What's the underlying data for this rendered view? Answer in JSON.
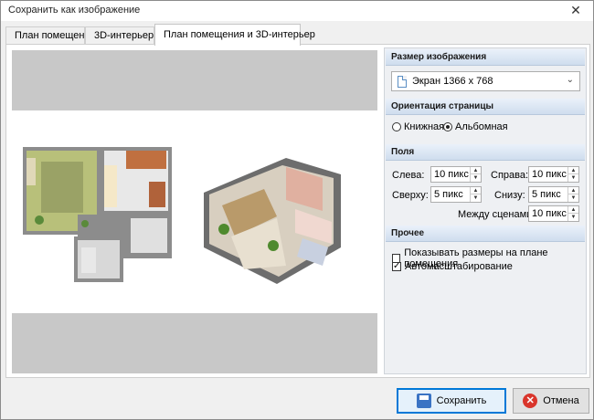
{
  "window": {
    "title": "Сохранить как изображение",
    "close_icon": "✕"
  },
  "tabs": [
    {
      "label": "План помещения"
    },
    {
      "label": "3D-интерьер"
    },
    {
      "label": "План помещения и 3D-интерьер",
      "active": true
    }
  ],
  "image_size": {
    "header": "Размер изображения",
    "selected": "Экран 1366 x 768"
  },
  "orientation": {
    "header": "Ориентация страницы",
    "options": [
      {
        "label": "Книжная",
        "selected": false
      },
      {
        "label": "Альбомная",
        "selected": true
      }
    ]
  },
  "margins": {
    "header": "Поля",
    "left_label": "Слева:",
    "left_value": "10 пикс",
    "right_label": "Справа:",
    "right_value": "10 пикс",
    "top_label": "Сверху:",
    "top_value": "5 пикс",
    "bottom_label": "Снизу:",
    "bottom_value": "5 пикс",
    "between_label": "Между сценами:",
    "between_value": "10 пикс"
  },
  "other": {
    "header": "Прочее",
    "show_sizes_label": "Показывать размеры на плане помещения",
    "show_sizes_checked": false,
    "autoscale_label": "Автомасштабирование",
    "autoscale_checked": true
  },
  "buttons": {
    "save": "Сохранить",
    "cancel": "Отмена"
  },
  "colors": {
    "accent": "#0078d7",
    "section_header": "#cfddee"
  }
}
